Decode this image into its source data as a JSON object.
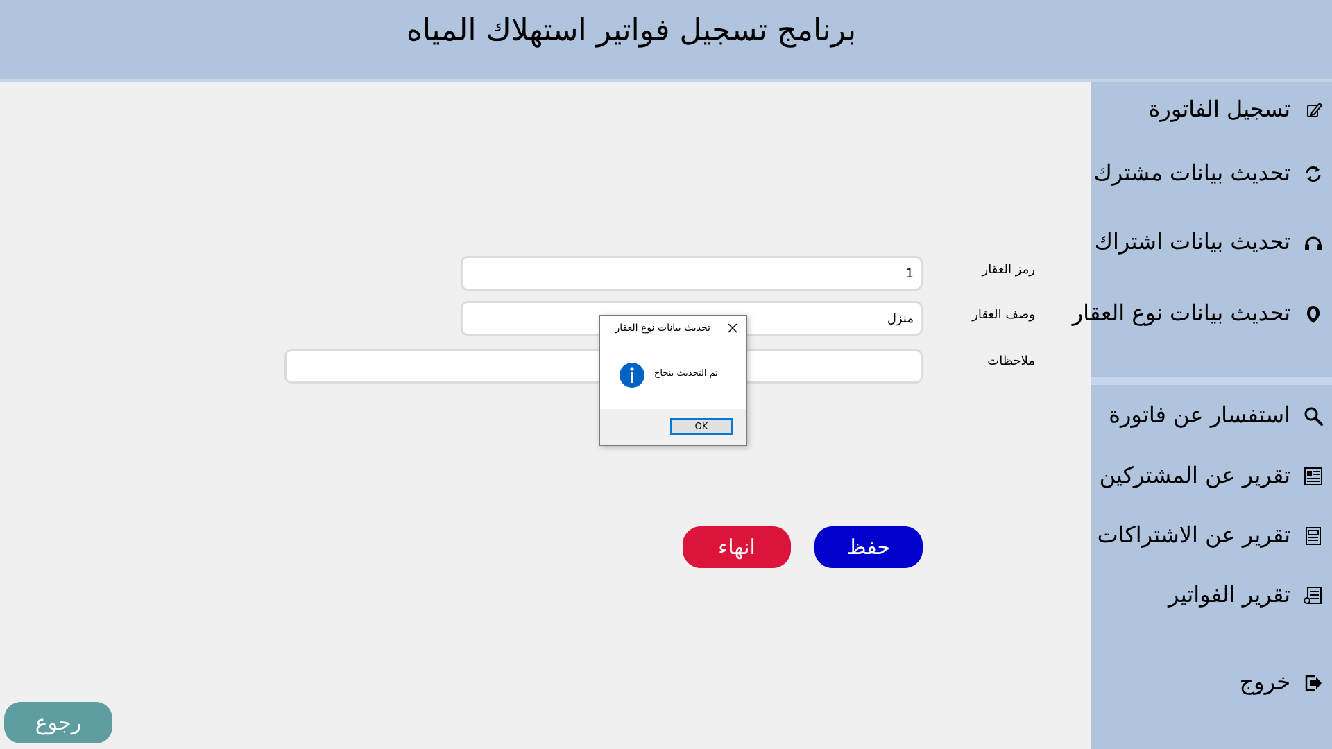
{
  "header": {
    "title": "برنامج تسجيل فواتير استهلاك المياه"
  },
  "sidebar": {
    "items": [
      {
        "label": "تسجيل الفاتورة",
        "icon": "edit-icon"
      },
      {
        "label": "تحديث بيانات مشترك",
        "icon": "refresh-icon"
      },
      {
        "label": "تحديث بيانات اشتراك",
        "icon": "headset-icon"
      },
      {
        "label": "تحديث بيانات نوع العقار",
        "icon": "location-pin-icon"
      },
      {
        "label": "استفسار عن فاتورة",
        "icon": "search-icon"
      },
      {
        "label": "تقرير عن المشتركين",
        "icon": "report-icon"
      },
      {
        "label": "تقرير عن الاشتراكات",
        "icon": "report-icon"
      },
      {
        "label": "تقرير الفواتير",
        "icon": "receipt-icon"
      },
      {
        "label": "خروج",
        "icon": "exit-icon"
      }
    ]
  },
  "form": {
    "property_code": {
      "label": "رمز العقار",
      "value": "1"
    },
    "property_description": {
      "label": "وصف العقار",
      "value": "منزل"
    },
    "notes": {
      "label": "ملاحظات",
      "value": ""
    }
  },
  "buttons": {
    "save": "حفظ",
    "end": "انهاء",
    "back": "رجوع"
  },
  "dialog": {
    "title": "تحديث بيانات نوع العقار",
    "message": "تم التحديث بنجاح",
    "ok": "OK"
  },
  "colors": {
    "header_bg": "#b0c4de",
    "save_button": "#0000cd",
    "end_button": "#dc143c",
    "back_button": "#5f9ea0",
    "info_icon": "#0063c4"
  }
}
